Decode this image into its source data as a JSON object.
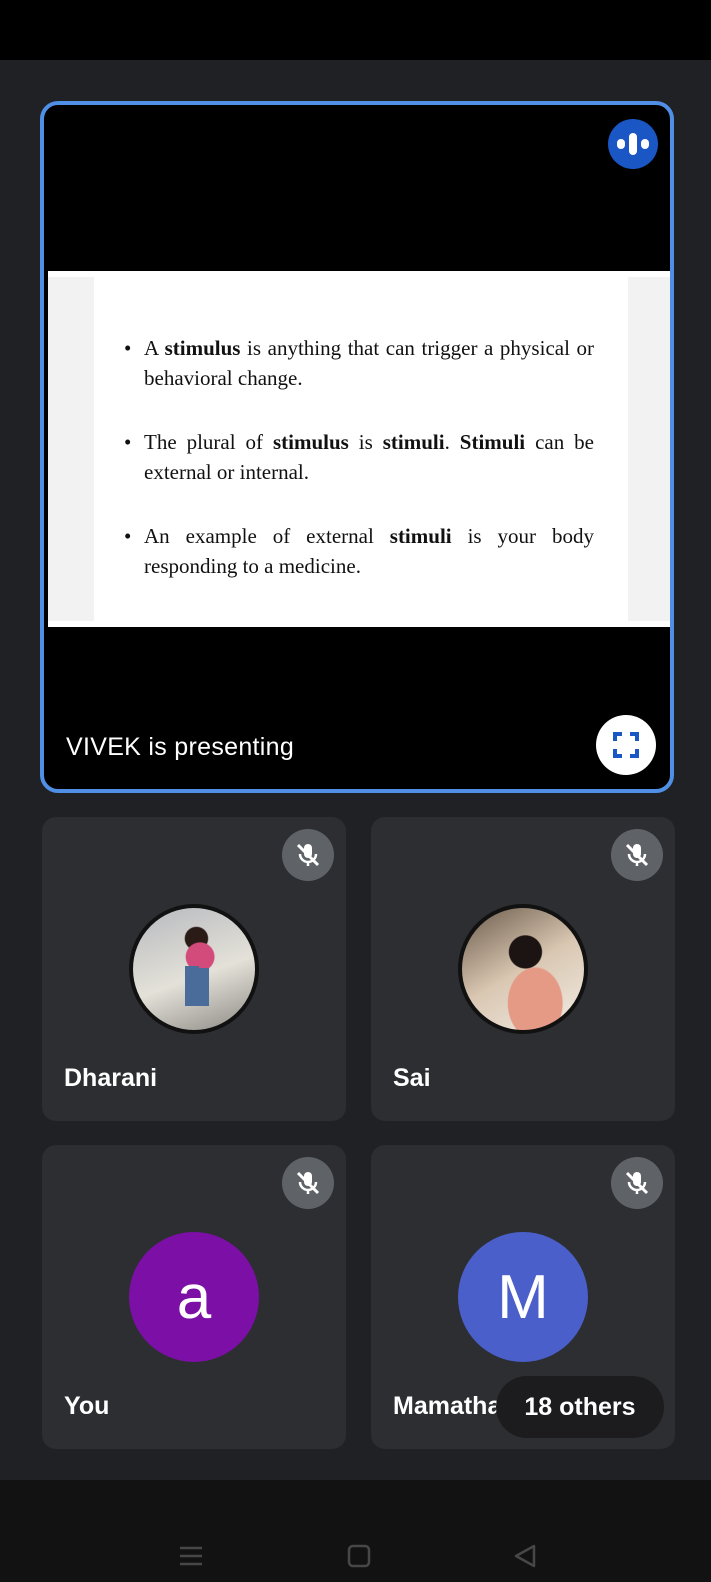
{
  "presentation": {
    "presenting_label": "VIVEK is presenting",
    "slide_bullets": [
      {
        "parts": [
          {
            "t": "A "
          },
          {
            "t": "stimulus",
            "b": true
          },
          {
            "t": " is anything that can trigger a physical or behavioral change."
          }
        ]
      },
      {
        "parts": [
          {
            "t": "The plural of "
          },
          {
            "t": "stimulus",
            "b": true
          },
          {
            "t": " is "
          },
          {
            "t": "stimuli",
            "b": true
          },
          {
            "t": ". "
          },
          {
            "t": "Stimuli",
            "b": true
          },
          {
            "t": " can be external or internal."
          }
        ]
      },
      {
        "parts": [
          {
            "t": "An example of external "
          },
          {
            "t": "stimuli",
            "b": true
          },
          {
            "t": " is your body responding to a medicine."
          }
        ]
      }
    ],
    "audio_icon": "audio-level-icon",
    "fullscreen_icon": "fullscreen-icon"
  },
  "participants": [
    {
      "name": "Dharani",
      "avatar_type": "photo",
      "muted": true
    },
    {
      "name": "Sai",
      "avatar_type": "photo",
      "muted": true
    },
    {
      "name": "You",
      "avatar_type": "letter",
      "letter": "a",
      "color": "#7b0fa6",
      "muted": true
    },
    {
      "name": "Mamatha",
      "avatar_type": "letter",
      "letter": "M",
      "color": "#4a5fc9",
      "muted": true
    }
  ],
  "others_label": "18 others",
  "colors": {
    "accent_border": "#4f8fe6",
    "audio_badge": "#1a56c4"
  }
}
